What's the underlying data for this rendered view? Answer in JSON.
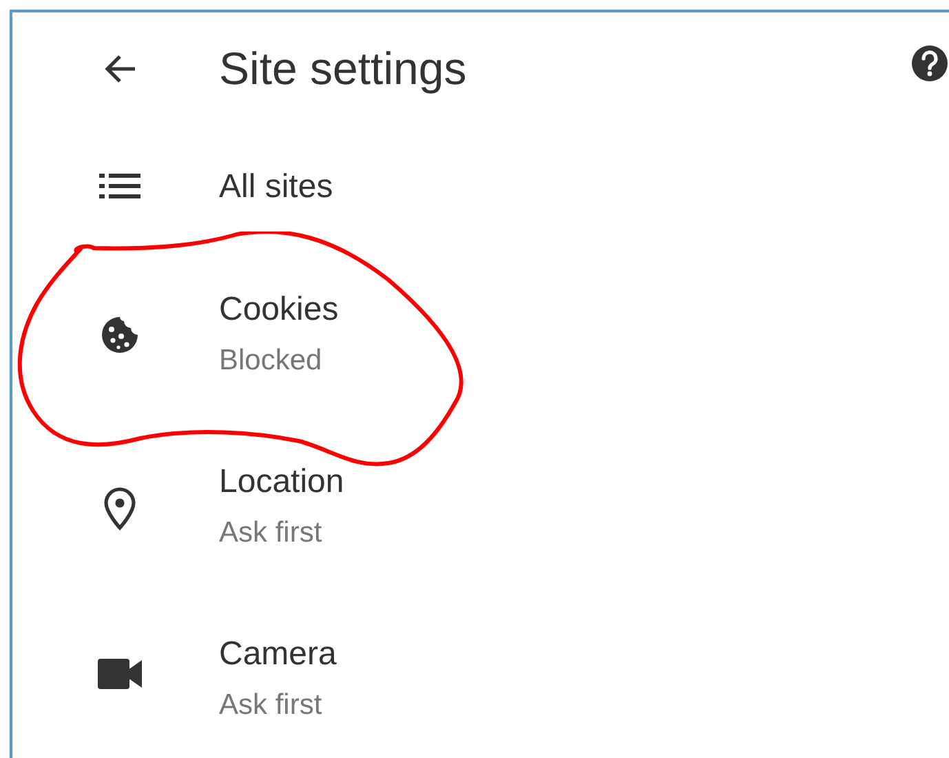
{
  "header": {
    "title": "Site settings"
  },
  "items": [
    {
      "title": "All sites",
      "highlighted": false
    },
    {
      "title": "Cookies",
      "subtitle": "Blocked",
      "highlighted": true
    },
    {
      "title": "Location",
      "subtitle": "Ask first",
      "highlighted": false
    },
    {
      "title": "Camera",
      "subtitle": "Ask first",
      "highlighted": false
    }
  ]
}
